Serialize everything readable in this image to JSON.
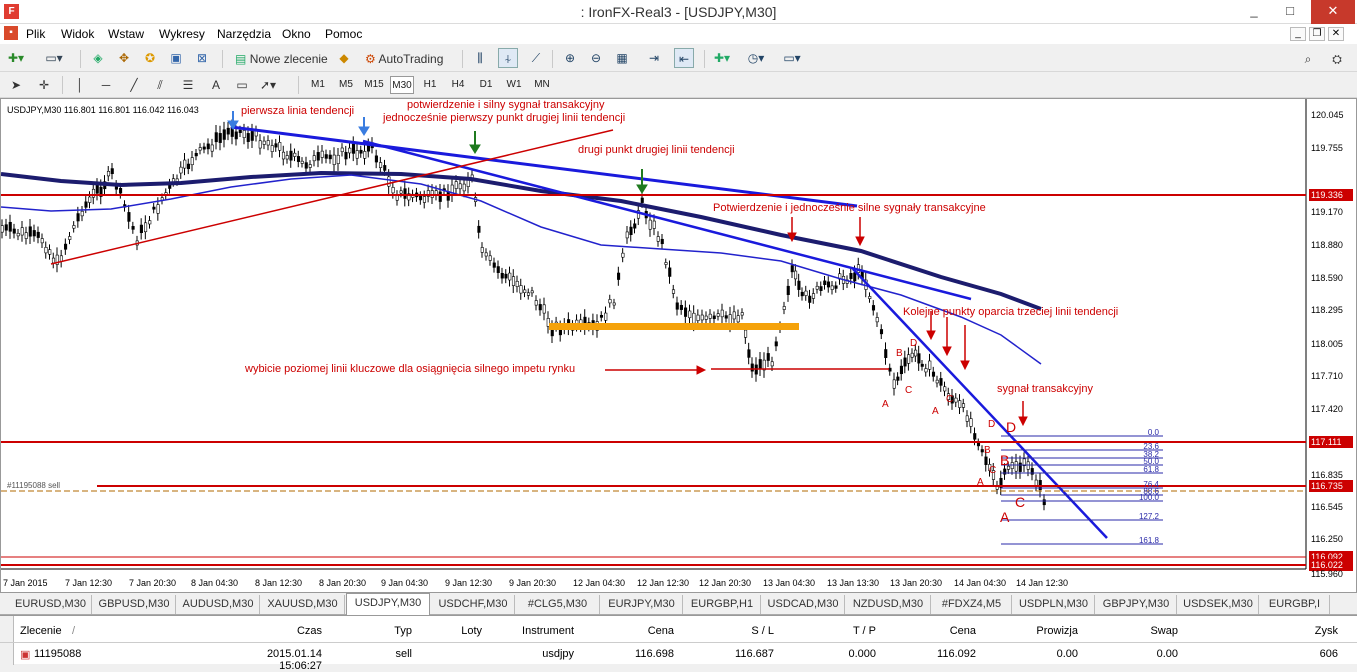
{
  "window": {
    "title": ": IronFX-Real3 - [USDJPY,M30]",
    "minimize": "_",
    "maximize": "□",
    "close": "✕"
  },
  "menu": {
    "items": [
      "Plik",
      "Widok",
      "Wstaw",
      "Wykresy",
      "Narzędzia",
      "Okno",
      "Pomoc"
    ]
  },
  "toolbar": {
    "new_order": "Nowe zlecenie",
    "autotrading": "AutoTrading",
    "timeframes": [
      "M1",
      "M5",
      "M15",
      "M30",
      "H1",
      "H4",
      "D1",
      "W1",
      "MN"
    ],
    "active_timeframe": "M30"
  },
  "chart": {
    "header": "USDJPY,M30  116.801 116.801 116.042 116.043",
    "price_labels": [
      "120.045",
      "119.755",
      "119.336",
      "119.170",
      "118.880",
      "118.590",
      "118.295",
      "118.005",
      "117.710",
      "117.420",
      "117.111",
      "116.835",
      "116.735",
      "116.545",
      "116.250",
      "116.092",
      "116.022",
      "115.960"
    ],
    "time_labels": [
      "7 Jan 2015",
      "7 Jan 12:30",
      "7 Jan 20:30",
      "8 Jan 04:30",
      "8 Jan 12:30",
      "8 Jan 20:30",
      "9 Jan 04:30",
      "9 Jan 12:30",
      "9 Jan 20:30",
      "12 Jan 04:30",
      "12 Jan 12:30",
      "12 Jan 20:30",
      "13 Jan 04:30",
      "13 Jan 13:30",
      "13 Jan 20:30",
      "14 Jan 04:30",
      "14 Jan 12:30"
    ],
    "order_label": "#11195088 sell",
    "fib_labels": [
      "0.0",
      "23.6",
      "38.2",
      "50.0",
      "61.8",
      "76.4",
      "88.6",
      "100.0",
      "127.2",
      "161.8"
    ],
    "annotations": {
      "a1": "pierwsza linia tendencji",
      "a2": "potwierdzenie i silny sygnał transakcyjny",
      "a3": "jednocześnie pierwszy punkt drugiej linii tendencji",
      "a4": "drugi punkt drugiej linii tendencji",
      "a5": "Potwierdzenie i jednocześnie silne sygnały transakcyjne",
      "a6": "Kolejne punkty oparcia trzeciej linii tendencji",
      "a7": "wybicie poziomej linii kluczowe dla osiągnięcia silnego impetu rynku",
      "a8": "sygnał transakcyjny"
    },
    "pattern_letters": [
      "A",
      "B",
      "C",
      "D"
    ],
    "colors": {
      "trend": "#1a1adc",
      "support": "#cc0000",
      "ma_dark": "#1c1c6e",
      "zone": "#f5a20a",
      "arrow_blue": "#3a7de0",
      "arrow_green": "#1f7a1f"
    }
  },
  "tabs": [
    "EURUSD,M30",
    "GBPUSD,M30",
    "AUDUSD,M30",
    "XAUUSD,M30",
    "USDJPY,M30",
    "USDCHF,M30",
    "#CLG5,M30",
    "EURJPY,M30",
    "EURGBP,H1",
    "USDCAD,M30",
    "NZDUSD,M30",
    "#FDXZ4,M5",
    "USDPLN,M30",
    "GBPJPY,M30",
    "USDSEK,M30",
    "EURGBP,I"
  ],
  "active_tab": "USDJPY,M30",
  "terminal": {
    "headers": [
      "Zlecenie",
      "/",
      "Czas",
      "Typ",
      "Loty",
      "Instrument",
      "Cena",
      "S / L",
      "T / P",
      "Cena",
      "Prowizja",
      "Swap",
      "Zysk"
    ],
    "row": [
      "11195088",
      "2015.01.14 15:06:27",
      "sell",
      "",
      "usdjpy",
      "116.698",
      "116.687",
      "0.000",
      "116.092",
      "0.00",
      "0.00",
      "606"
    ]
  }
}
